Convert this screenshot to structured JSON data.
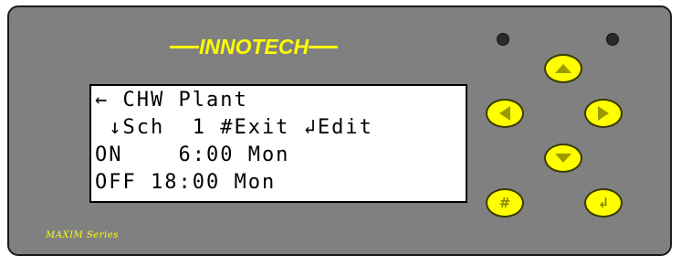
{
  "brand": {
    "name": "INNOTECH",
    "series": "MAXIM Series",
    "accent_color": "#ffff00",
    "panel_color": "#808080"
  },
  "lcd": {
    "line1": "← CHW Plant",
    "line2": " ↓Sch  1 #Exit ↲Edit",
    "line3": "ON    6:00 Mon",
    "line4": "OFF 18:00 Mon"
  },
  "buttons": {
    "up": {
      "icon": "arrow-up-icon"
    },
    "left": {
      "icon": "arrow-left-icon"
    },
    "right": {
      "icon": "arrow-right-icon"
    },
    "down": {
      "icon": "arrow-down-icon"
    },
    "hash": {
      "icon": "hash-icon",
      "label": "#"
    },
    "enter": {
      "icon": "enter-icon",
      "label": "↲"
    }
  },
  "indicators": [
    {
      "icon": "led-indicator-icon"
    },
    {
      "icon": "led-indicator-icon"
    }
  ]
}
